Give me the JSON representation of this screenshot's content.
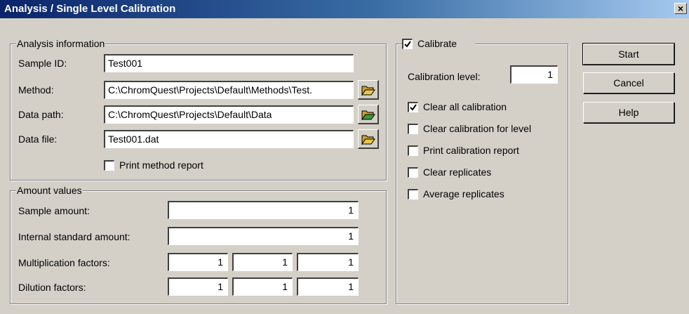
{
  "window": {
    "title": "Analysis / Single Level Calibration",
    "close_glyph": "×"
  },
  "analysis_info": {
    "legend": "Analysis information",
    "sample_id": {
      "label": "Sample ID:",
      "value": "Test001"
    },
    "method": {
      "label": "Method:",
      "value": "C:\\ChromQuest\\Projects\\Default\\Methods\\Test."
    },
    "data_path": {
      "label": "Data path:",
      "value": "C:\\ChromQuest\\Projects\\Default\\Data"
    },
    "data_file": {
      "label": "Data file:",
      "value": "Test001.dat"
    },
    "print_method_report": {
      "label": "Print method report",
      "checked": false
    }
  },
  "amount_values": {
    "legend": "Amount values",
    "sample_amount": {
      "label": "Sample amount:",
      "value": "1"
    },
    "internal_standard_amount": {
      "label": "Internal standard amount:",
      "value": "1"
    },
    "multiplication_factors": {
      "label": "Multiplication factors:",
      "values": [
        "1",
        "1",
        "1"
      ]
    },
    "dilution_factors": {
      "label": "Dilution factors:",
      "values": [
        "1",
        "1",
        "1"
      ]
    }
  },
  "calibrate": {
    "legend": "Calibrate",
    "checked": true,
    "level": {
      "label": "Calibration level:",
      "value": "1"
    },
    "options": [
      {
        "label": "Clear all calibration",
        "checked": true
      },
      {
        "label": "Clear calibration for level",
        "checked": false
      },
      {
        "label": "Print calibration report",
        "checked": false
      },
      {
        "label": "Clear replicates",
        "checked": false
      },
      {
        "label": "Average replicates",
        "checked": false
      }
    ]
  },
  "buttons": {
    "start": "Start",
    "cancel": "Cancel",
    "help": "Help"
  },
  "icons": {
    "browse": "open-folder-icon",
    "check": "checkmark-icon"
  },
  "colors": {
    "title_bar_start": "#0a246a",
    "title_bar_end": "#a6caf0",
    "dialog_bg": "#d4d0c8",
    "folder": "#e8c84a"
  }
}
